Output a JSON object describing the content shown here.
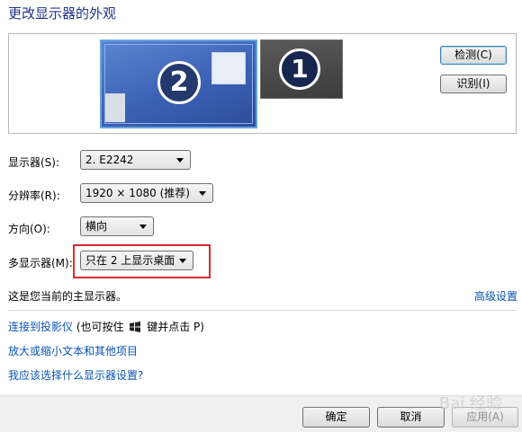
{
  "title": "更改显示器的外观",
  "preview": {
    "monitors": [
      {
        "number": "2",
        "selected": true
      },
      {
        "number": "1",
        "selected": false
      }
    ]
  },
  "buttons": {
    "detect": "检测(C)",
    "identify": "识别(I)"
  },
  "settings": {
    "display": {
      "label": "显示器(S):",
      "value": "2. E2242"
    },
    "resolution": {
      "label": "分辨率(R):",
      "value": "1920 × 1080 (推荐)"
    },
    "orientation": {
      "label": "方向(O):",
      "value": "横向"
    },
    "multi_display": {
      "label": "多显示器(M):",
      "value": "只在 2 上显示桌面"
    }
  },
  "primary_note": "这是您当前的主显示器。",
  "advanced_link": "高级设置",
  "links": {
    "projector": "连接到投影仪",
    "projector_hint_pre": "(也可按住",
    "projector_hint_post": "键并点击 P)",
    "text_size": "放大或缩小文本和其他项目",
    "help": "我应该选择什么显示器设置?"
  },
  "footer": {
    "ok": "确定",
    "cancel": "取消",
    "apply": "应用(A)"
  },
  "watermark": "Bai 经验",
  "colors": {
    "title": "#1e3287",
    "link": "#0a54b4",
    "highlight": "#e0292f",
    "selected_monitor": "#3d63b8"
  }
}
